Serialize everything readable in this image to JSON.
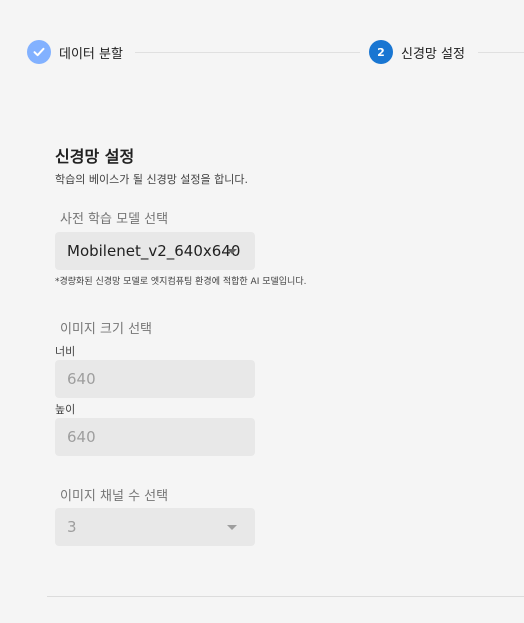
{
  "stepper": {
    "steps": [
      {
        "label": "데이터 분할",
        "state": "completed",
        "number": "1"
      },
      {
        "label": "신경망 설정",
        "state": "active",
        "number": "2"
      }
    ]
  },
  "section": {
    "title": "신경망 설정",
    "description": "학습의 베이스가 될 신경망 설정을 합니다."
  },
  "model_select": {
    "title": "사전 학습 모델 선택",
    "value": "Mobilenet_v2_640x640",
    "hint": "*경량화된 신경망 모델로 엣지컴퓨팅 환경에 적합한 AI 모델입니다."
  },
  "image_size": {
    "title": "이미지 크기 선택",
    "width_label": "너비",
    "width_value": "640",
    "height_label": "높이",
    "height_value": "640"
  },
  "channel_select": {
    "title": "이미지 채널 수 선택",
    "value": "3"
  },
  "colors": {
    "accent": "#1976d2",
    "completed": "#82b1ff",
    "field_bg": "#e8e8e8",
    "page_bg": "#f5f5f5"
  }
}
